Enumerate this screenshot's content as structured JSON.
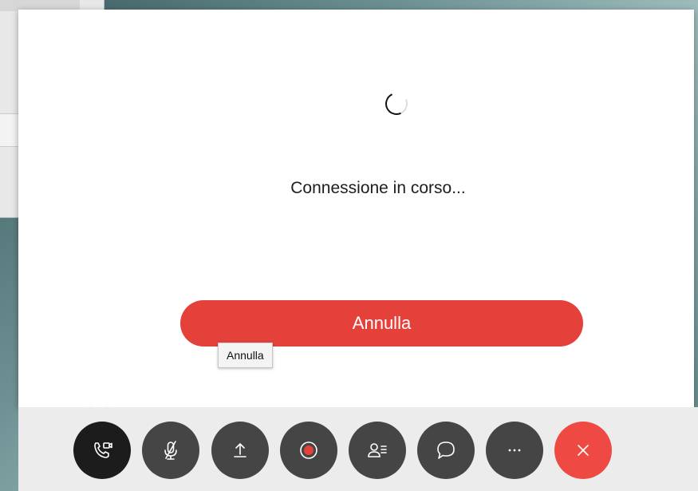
{
  "dialog": {
    "status_text": "Connessione in corso...",
    "cancel_label": "Annulla",
    "tooltip_text": "Annulla"
  },
  "controls": [
    {
      "name": "video-connection-button",
      "icon": "phone-video-icon"
    },
    {
      "name": "mute-button",
      "icon": "microphone-muted-icon"
    },
    {
      "name": "share-button",
      "icon": "upload-icon"
    },
    {
      "name": "record-button",
      "icon": "record-icon"
    },
    {
      "name": "participants-button",
      "icon": "participants-icon"
    },
    {
      "name": "chat-button",
      "icon": "chat-bubble-icon"
    },
    {
      "name": "more-options-button",
      "icon": "ellipsis-icon"
    },
    {
      "name": "leave-meeting-button",
      "icon": "close-icon"
    }
  ],
  "colors": {
    "accent_red": "#e5413b",
    "control_dark": "#454545",
    "control_active": "#1c1c1c",
    "leave_red": "#ee4a43"
  }
}
